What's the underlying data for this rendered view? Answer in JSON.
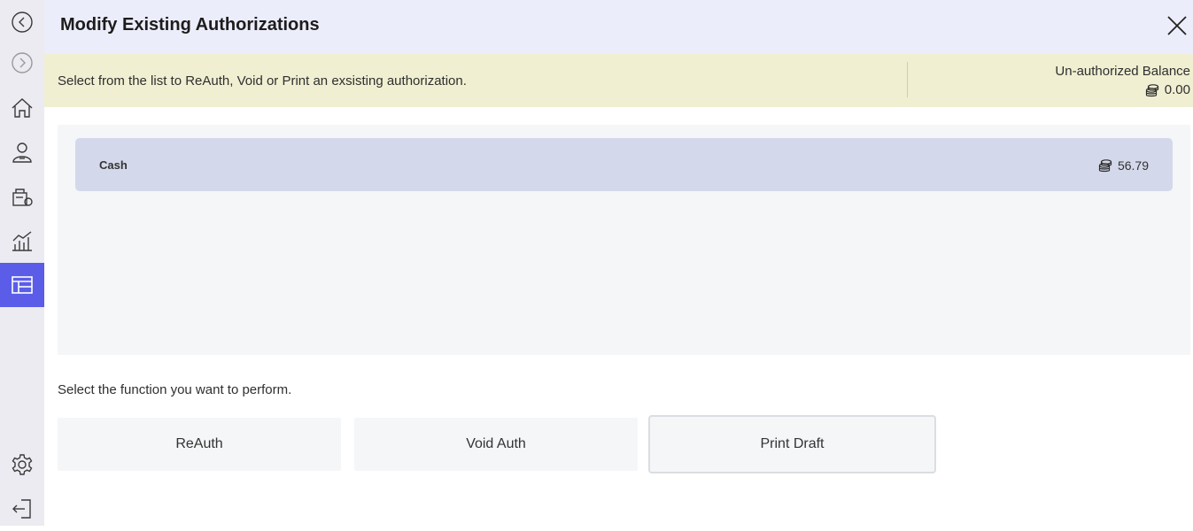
{
  "header": {
    "title": "Modify Existing Authorizations"
  },
  "banner": {
    "message": "Select from the list to ReAuth, Void or Print an exsisting authorization.",
    "balance_label": "Un-authorized Balance",
    "balance_value": "0.00"
  },
  "authorizations": [
    {
      "name": "Cash",
      "amount": "56.79"
    }
  ],
  "functions": {
    "prompt": "Select the function you want to perform.",
    "reauth_label": "ReAuth",
    "void_label": "Void Auth",
    "print_label": "Print Draft",
    "selected": "Print Draft"
  },
  "sidebar": {
    "items": [
      "back-icon",
      "forward-icon",
      "home-icon",
      "customer-icon",
      "register-icon",
      "analytics-icon",
      "layout-icon",
      "settings-icon",
      "logout-icon"
    ],
    "active": "layout-icon"
  },
  "colors": {
    "header_bg": "#ecedfa",
    "banner_bg": "#f0efd2",
    "active_nav": "#5b5de8",
    "list_item_bg": "#d4d8eb"
  }
}
